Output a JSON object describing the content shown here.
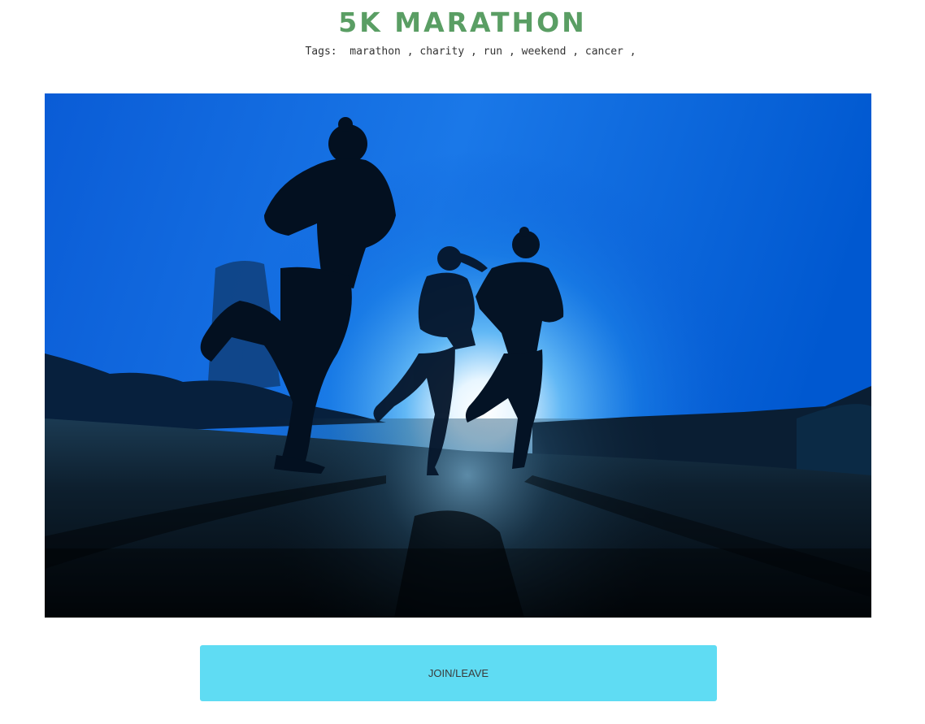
{
  "event": {
    "title": "5K MARATHON",
    "title_color": "#5a9e64"
  },
  "tags": {
    "label": "Tags:",
    "separator": ",",
    "items": [
      "marathon",
      "charity",
      "run",
      "weekend",
      "cancer"
    ]
  },
  "hero_image": {
    "description_icon": "runners-silhouette-photo"
  },
  "actions": {
    "join_leave_label": "JOIN/LEAVE",
    "button_color": "#5fdcf3"
  }
}
